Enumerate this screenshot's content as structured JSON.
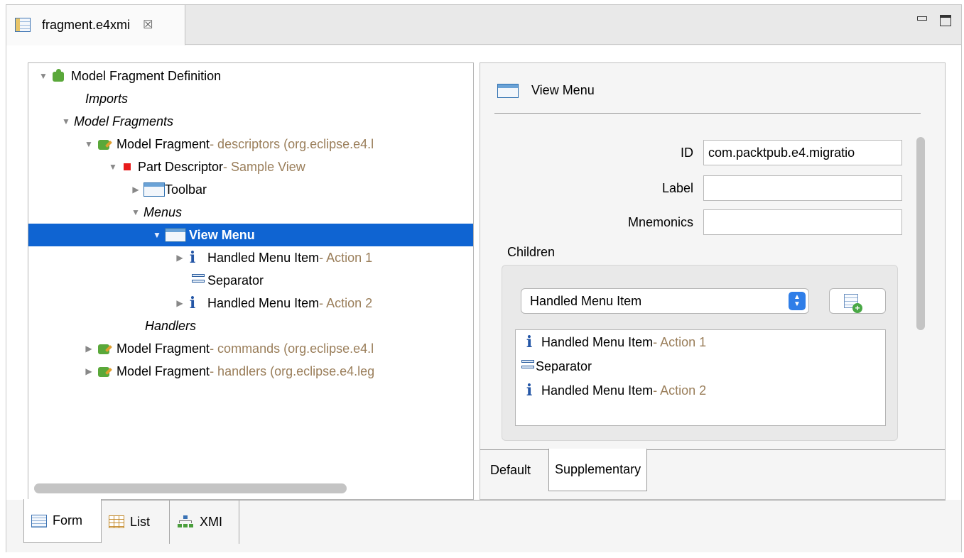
{
  "editor_tab": {
    "title": "fragment.e4xmi",
    "close_glyph": "☒"
  },
  "tree": {
    "rows": [
      {
        "label": "Model Fragment Definition",
        "detail": ""
      },
      {
        "label": "Imports",
        "detail": ""
      },
      {
        "label": "Model Fragments",
        "detail": ""
      },
      {
        "label": "Model Fragment",
        "detail": " - descriptors (org.eclipse.e4.l"
      },
      {
        "label": "Part Descriptor",
        "detail": " - Sample View"
      },
      {
        "label": "Toolbar",
        "detail": ""
      },
      {
        "label": "Menus",
        "detail": ""
      },
      {
        "label": "View Menu",
        "detail": ""
      },
      {
        "label": "Handled Menu Item",
        "detail": " - Action 1"
      },
      {
        "label": "Separator",
        "detail": ""
      },
      {
        "label": "Handled Menu Item",
        "detail": " - Action 2"
      },
      {
        "label": "Handlers",
        "detail": ""
      },
      {
        "label": "Model Fragment",
        "detail": " - commands (org.eclipse.e4.l"
      },
      {
        "label": "Model Fragment",
        "detail": " - handlers (org.eclipse.e4.leg"
      }
    ],
    "selected_index": 7
  },
  "form": {
    "header": "View Menu",
    "id_label": "ID",
    "id_value": "com.packtpub.e4.migratio",
    "label_label": "Label",
    "label_value": "",
    "mnemonics_label": "Mnemonics",
    "mnemonics_value": "",
    "children_label": "Children",
    "child_type_selected": "Handled Menu Item",
    "children": [
      {
        "label": "Handled Menu Item",
        "detail": " - Action 1"
      },
      {
        "label": "Separator",
        "detail": ""
      },
      {
        "label": "Handled Menu Item",
        "detail": " - Action 2"
      }
    ],
    "tabs": [
      "Default",
      "Supplementary"
    ]
  },
  "bottom_tabs": [
    "Form",
    "List",
    "XMI"
  ],
  "colors": {
    "selection": "#0f64d2",
    "detail_text": "#9a7e5a"
  }
}
